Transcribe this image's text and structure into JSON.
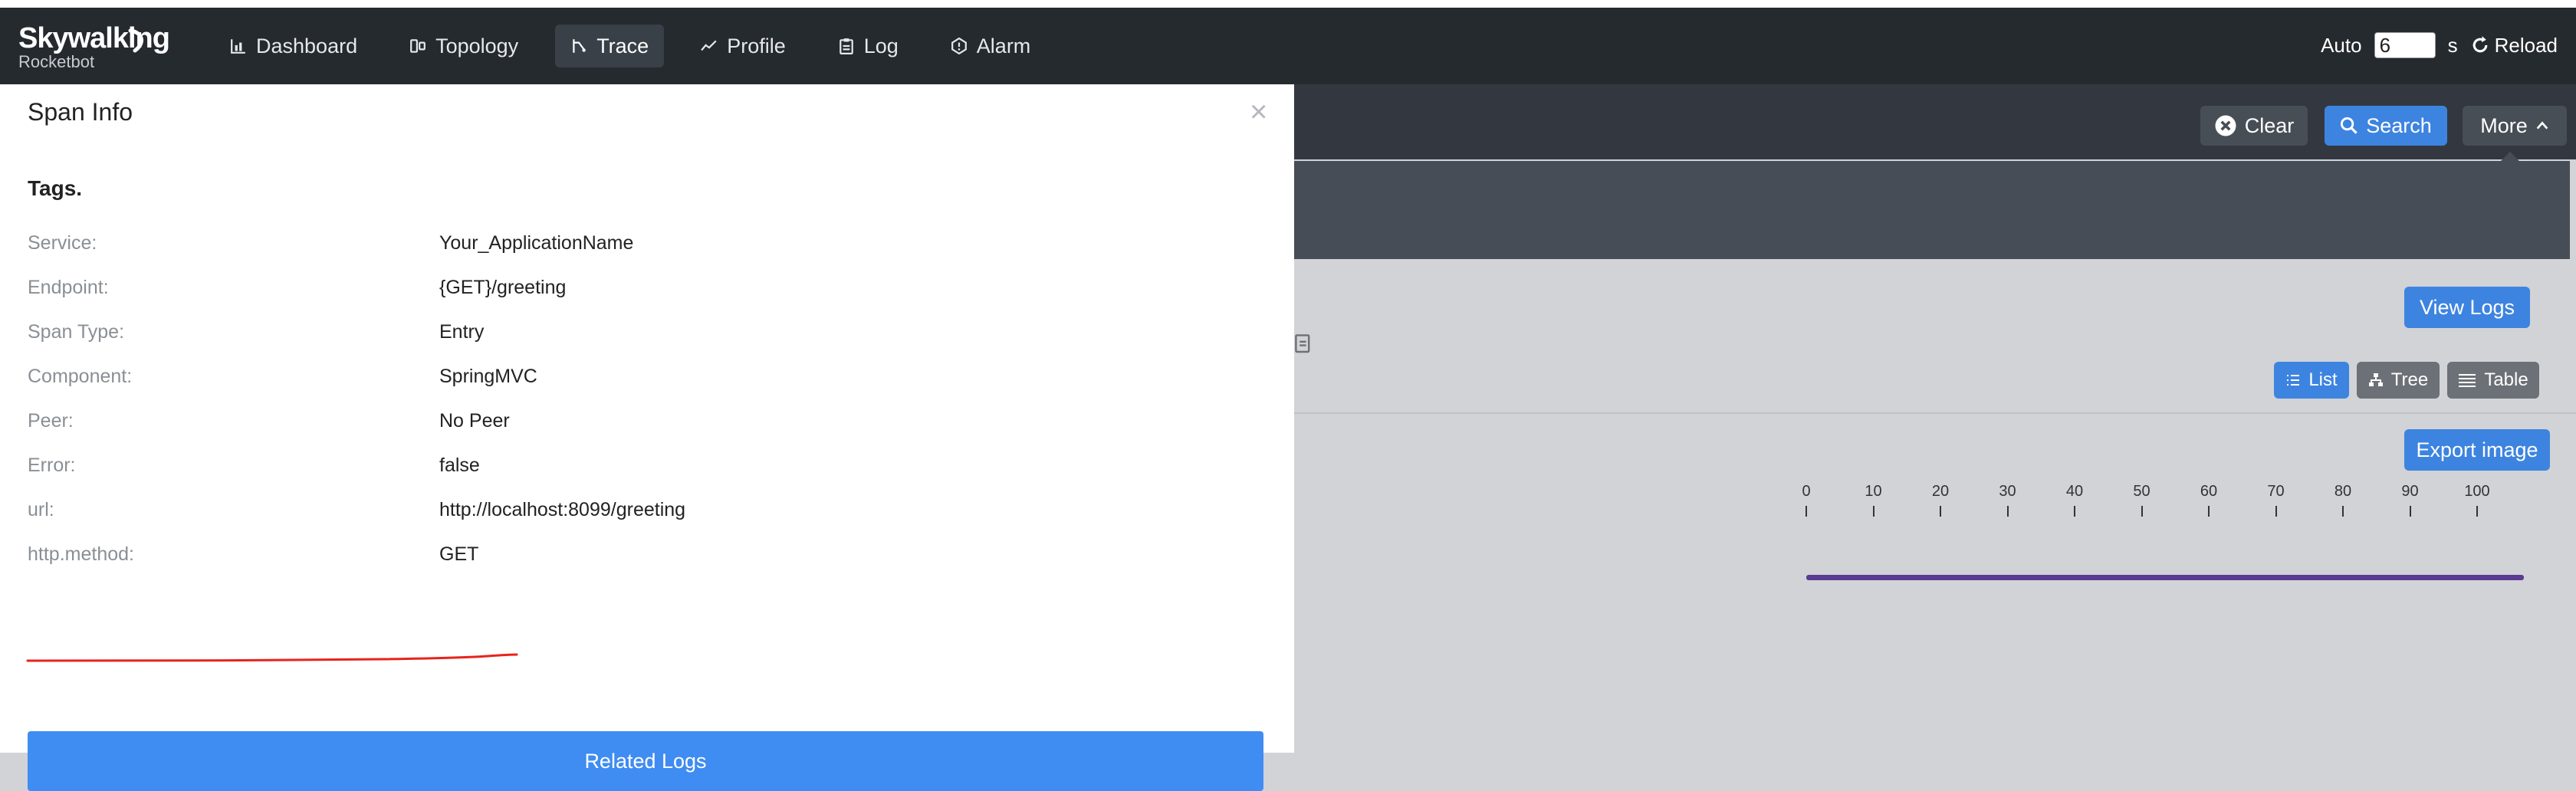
{
  "nav": {
    "logo": "Skywalking",
    "logo_sub": "Rocketbot",
    "items": [
      {
        "label": "Dashboard",
        "icon": "bar-chart-icon",
        "active": false
      },
      {
        "label": "Topology",
        "icon": "topology-icon",
        "active": false
      },
      {
        "label": "Trace",
        "icon": "trace-icon",
        "active": true
      },
      {
        "label": "Profile",
        "icon": "line-chart-icon",
        "active": false
      },
      {
        "label": "Log",
        "icon": "clipboard-icon",
        "active": false
      },
      {
        "label": "Alarm",
        "icon": "alarm-icon",
        "active": false
      }
    ],
    "auto_label": "Auto",
    "auto_value": "6",
    "seconds_label": "s",
    "reload_label": "Reload"
  },
  "search": {
    "clear_label": "Clear",
    "search_label": "Search",
    "more_label": "More"
  },
  "detail": {
    "view_logs_label": "View Logs",
    "list_label": "List",
    "tree_label": "Tree",
    "table_label": "Table",
    "export_label": "Export image",
    "ruler_ticks": [
      "0",
      "10",
      "20",
      "30",
      "40",
      "50",
      "60",
      "70",
      "80",
      "90",
      "100"
    ]
  },
  "modal": {
    "title": "Span Info",
    "close_glyph": "×",
    "tags_heading": "Tags.",
    "tags": [
      {
        "key": "Service:",
        "value": "Your_ApplicationName"
      },
      {
        "key": "Endpoint:",
        "value": "{GET}/greeting"
      },
      {
        "key": "Span Type:",
        "value": "Entry"
      },
      {
        "key": "Component:",
        "value": "SpringMVC"
      },
      {
        "key": "Peer:",
        "value": "No Peer"
      },
      {
        "key": "Error:",
        "value": "false"
      },
      {
        "key": "url:",
        "value": "http://localhost:8099/greeting"
      },
      {
        "key": "http.method:",
        "value": "GET"
      }
    ],
    "related_logs_label": "Related Logs"
  },
  "colors": {
    "nav_bg": "#252a2f",
    "primary": "#3d84e0",
    "annotation_red": "#e8231a",
    "span_bar": "#5b3b93"
  }
}
